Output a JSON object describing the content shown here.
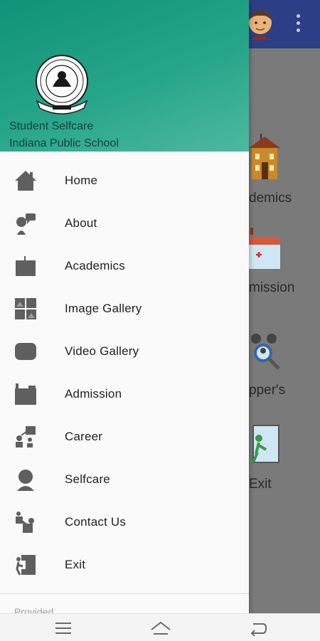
{
  "app": {
    "background_tiles": [
      {
        "label": "demics",
        "icon": "school-building-icon"
      },
      {
        "label": "mission",
        "icon": "admission-calendar-icon"
      },
      {
        "label": "pper's",
        "icon": "toppers-search-icon"
      },
      {
        "label": "Exit",
        "icon": "exit-door-icon"
      }
    ]
  },
  "drawer": {
    "header": {
      "title": "Student Selfcare",
      "subtitle": "Indiana Public School"
    },
    "menu": [
      {
        "label": "Home",
        "icon": "home-icon"
      },
      {
        "label": "About",
        "icon": "about-icon"
      },
      {
        "label": "Academics",
        "icon": "academics-icon"
      },
      {
        "label": "Image Gallery",
        "icon": "image-gallery-icon"
      },
      {
        "label": "Video Gallery",
        "icon": "video-gallery-icon"
      },
      {
        "label": "Admission",
        "icon": "admission-icon"
      },
      {
        "label": "Career",
        "icon": "career-icon"
      },
      {
        "label": "Selfcare",
        "icon": "selfcare-icon"
      },
      {
        "label": "Contact Us",
        "icon": "contact-us-icon"
      },
      {
        "label": "Exit",
        "icon": "exit-icon"
      }
    ],
    "footer_text": "Provided"
  },
  "navbar": {
    "buttons": [
      "menu-icon",
      "home-icon",
      "back-icon"
    ]
  },
  "colors": {
    "header_start": "#0f9277",
    "header_end": "#4eb8a0",
    "app_bar": "#2c3e85",
    "icon_gray": "#5f5f5f"
  }
}
